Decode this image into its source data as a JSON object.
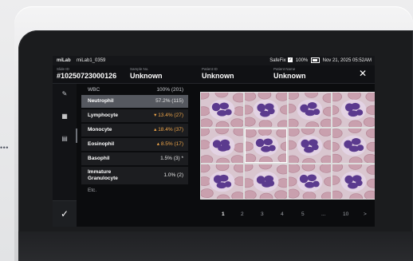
{
  "status_bar": {
    "brand": "miLab",
    "device": "miLab1_0359",
    "safefix_label": "SafeFix",
    "battery": "100%",
    "datetime": "Nov 21, 2025 05:52AM"
  },
  "header": {
    "slide_id_label": "Slide ID",
    "slide_id": "#10250723000126",
    "sample_label": "Sample No.",
    "sample_value": "Unknown",
    "patient_id_label": "Patient ID",
    "patient_id_value": "Unknown",
    "patient_name_label": "Patient Name",
    "patient_name_value": "Unknown",
    "close_symbol": "✕"
  },
  "sidebar": {
    "items": [
      {
        "icon": "edit-icon",
        "glyph": "✎"
      },
      {
        "icon": "grid-view-icon",
        "glyph": "▦"
      },
      {
        "icon": "report-icon",
        "glyph": "▤"
      }
    ],
    "confirm_symbol": "✓"
  },
  "wbc": {
    "header_label": "WBC",
    "header_value": "100% (201)",
    "rows": [
      {
        "name": "Neutrophil",
        "value": "57.2% (115)",
        "selected": true,
        "flag": ""
      },
      {
        "name": "Lymphocyte",
        "value": "▾ 13.4% (27)",
        "selected": false,
        "flag": "low"
      },
      {
        "name": "Monocyte",
        "value": "▴ 18.4% (37)",
        "selected": false,
        "flag": "high"
      },
      {
        "name": "Eosinophil",
        "value": "▴ 8.5% (17)",
        "selected": false,
        "flag": "high"
      },
      {
        "name": "Basophil",
        "value": "1.5% (3) *",
        "selected": false,
        "flag": ""
      },
      {
        "name": "Immature\nGranulocyte",
        "value": "1.0% (2)",
        "selected": false,
        "flag": ""
      }
    ],
    "etc_label": "Etc."
  },
  "pagination": {
    "pages": [
      "1",
      "2",
      "3",
      "4",
      "5",
      "...",
      "10",
      ">"
    ],
    "current": "1"
  },
  "colors": {
    "accent_orange": "#f0a64a",
    "selected_row": "#55585f",
    "cell_background": "#d9c6cf",
    "nucleus_purple": "#5b3a8e",
    "rbc_pink": "#c9a0ae"
  }
}
